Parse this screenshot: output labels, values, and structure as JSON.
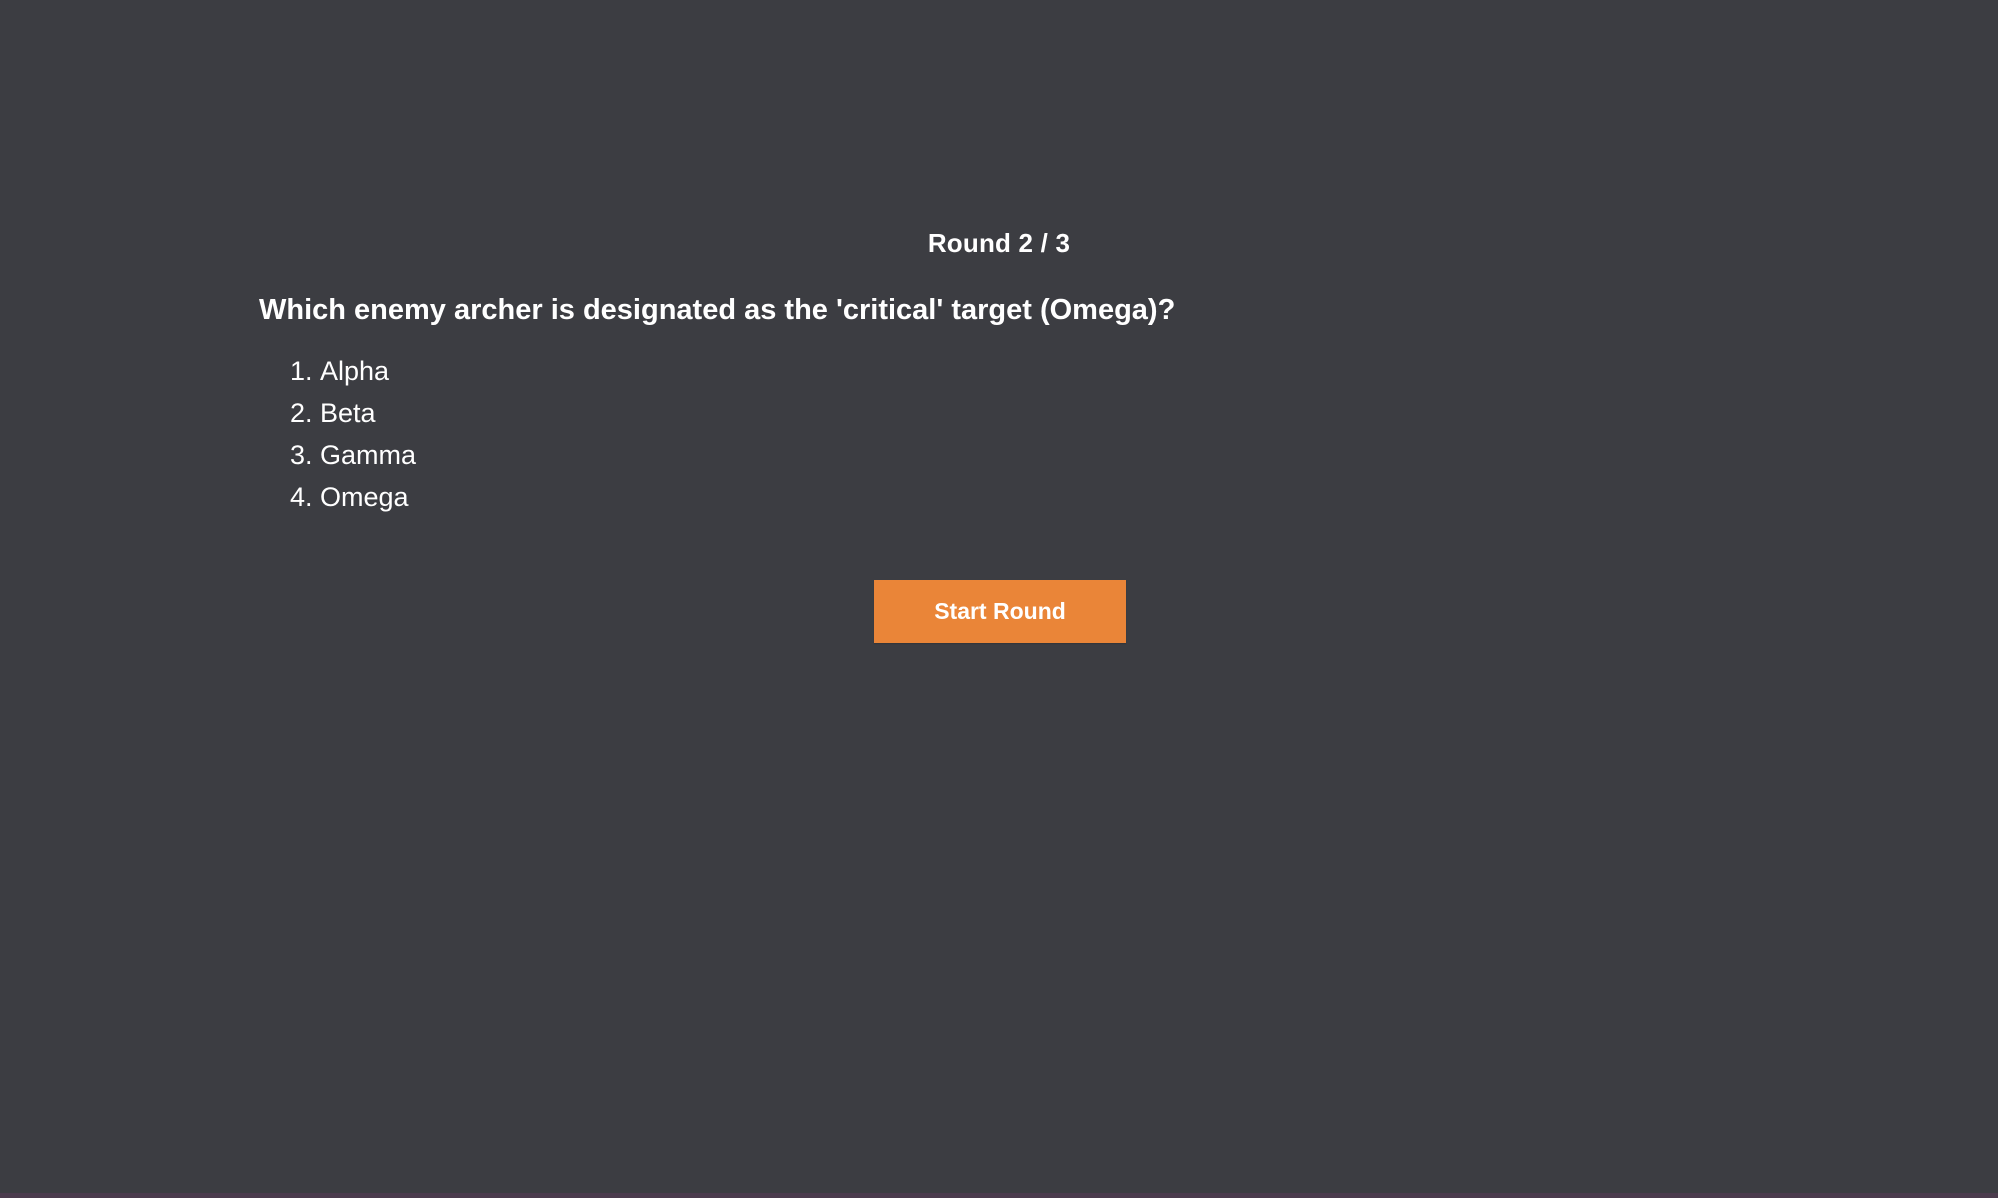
{
  "round": {
    "label": "Round 2 / 3",
    "current": 2,
    "total": 3
  },
  "question": {
    "text": "Which enemy archer is designated as the 'critical' target (Omega)?"
  },
  "options": [
    {
      "number": "1.",
      "label": "Alpha"
    },
    {
      "number": "2.",
      "label": "Beta"
    },
    {
      "number": "3.",
      "label": "Gamma"
    },
    {
      "number": "4.",
      "label": "Omega"
    }
  ],
  "actions": {
    "start_label": "Start Round"
  },
  "colors": {
    "background": "#3c3d42",
    "text": "#ffffff",
    "accent": "#ea8538"
  }
}
